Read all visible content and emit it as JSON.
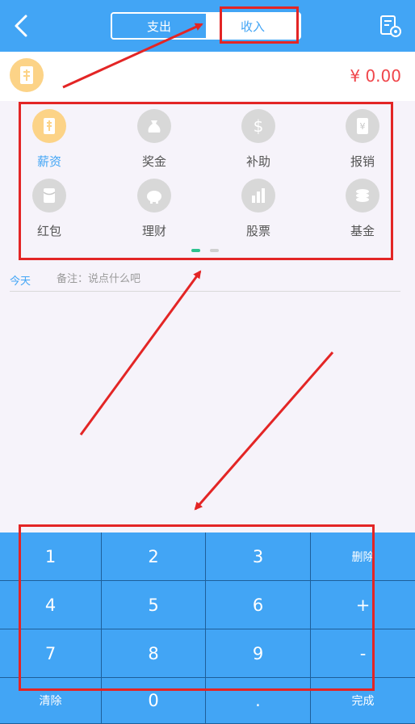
{
  "header": {
    "tabs": [
      {
        "label": "支出",
        "active": false
      },
      {
        "label": "收入",
        "active": true
      }
    ],
    "background": "#42a5f5"
  },
  "amount": {
    "value": "¥ 0.00",
    "color": "#f0464b"
  },
  "categories": [
    {
      "label": "薪资",
      "icon": "salary-doc-icon",
      "selected": true
    },
    {
      "label": "奖金",
      "icon": "bonus-bag-icon",
      "selected": false
    },
    {
      "label": "补助",
      "icon": "dollar-icon",
      "selected": false
    },
    {
      "label": "报销",
      "icon": "yen-receipt-icon",
      "selected": false
    },
    {
      "label": "红包",
      "icon": "red-packet-icon",
      "selected": false
    },
    {
      "label": "理财",
      "icon": "piggy-bank-icon",
      "selected": false
    },
    {
      "label": "股票",
      "icon": "stock-icon",
      "selected": false
    },
    {
      "label": "基金",
      "icon": "coins-icon",
      "selected": false
    }
  ],
  "pager": {
    "pages": 2,
    "current": 1,
    "active_color": "#2ec28f"
  },
  "note_row": {
    "date": "今天",
    "note_placeholder": "备注：说点什么吧"
  },
  "keypad": {
    "keys": [
      [
        "1",
        "2",
        "3",
        "删除"
      ],
      [
        "4",
        "5",
        "6",
        "+"
      ],
      [
        "7",
        "8",
        "9",
        "-"
      ],
      [
        "清除",
        "0",
        ".",
        "完成"
      ]
    ]
  },
  "annotation_color": "#e32525"
}
